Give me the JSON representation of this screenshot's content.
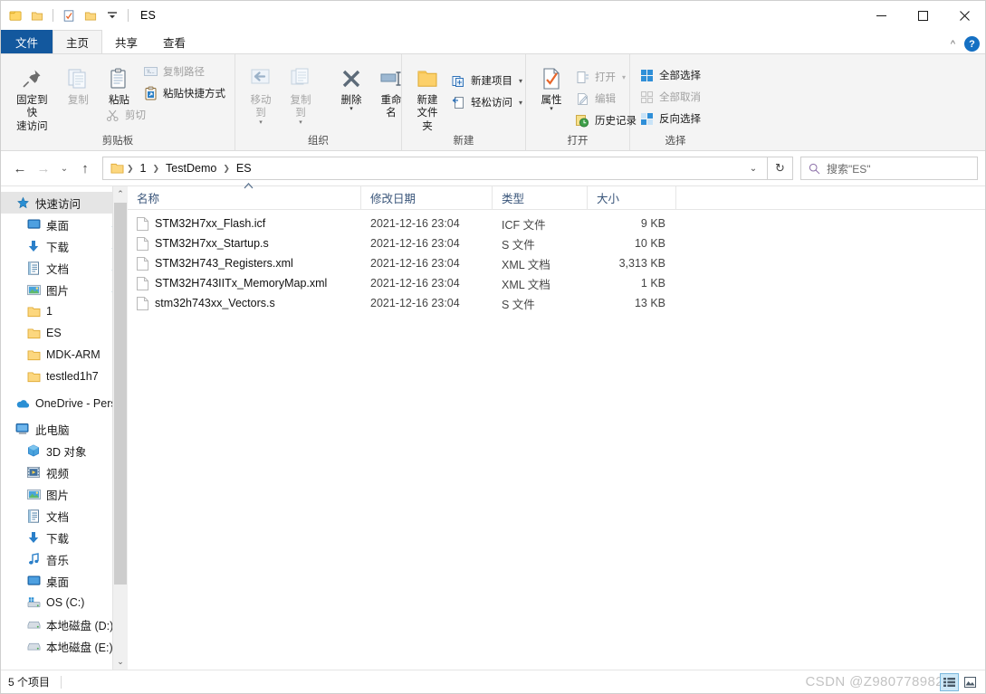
{
  "window": {
    "title": "ES",
    "quick_access": [
      "folder-icon",
      "properties-icon",
      "new-folder-icon",
      "dropdown-icon"
    ],
    "controls": {
      "minimize": "—",
      "maximize": "□",
      "close": "✕"
    }
  },
  "tabs": [
    {
      "label": "文件",
      "name": "tab-file"
    },
    {
      "label": "主页",
      "name": "tab-home"
    },
    {
      "label": "共享",
      "name": "tab-share"
    },
    {
      "label": "查看",
      "name": "tab-view"
    }
  ],
  "ribbon": {
    "collapse_label": "^",
    "help_label": "?",
    "groups": [
      {
        "name": "clipboard",
        "label": "剪贴板",
        "big": [
          {
            "label1": "固定到快",
            "label2": "速访问",
            "icon": "pin-icon",
            "disabled": false
          },
          {
            "label1": "复制",
            "label2": "",
            "icon": "copy-icon",
            "disabled": true
          },
          {
            "label1": "粘贴",
            "label2": "",
            "icon": "paste-icon",
            "disabled": false
          }
        ],
        "small": [
          {
            "label": "复制路径",
            "icon": "copy-path-icon",
            "disabled": true
          },
          {
            "label": "粘贴快捷方式",
            "icon": "paste-shortcut-icon",
            "disabled": false
          },
          {
            "label": "剪切",
            "icon": "scissors-icon",
            "disabled": true
          }
        ]
      },
      {
        "name": "organize",
        "label": "组织",
        "big": [
          {
            "label1": "移动到",
            "label2": "",
            "icon": "move-to-icon",
            "disabled": true,
            "caret": true
          },
          {
            "label1": "复制到",
            "label2": "",
            "icon": "copy-to-icon",
            "disabled": true,
            "caret": true
          },
          {
            "label1": "删除",
            "label2": "",
            "icon": "delete-icon",
            "disabled": false,
            "caret": true
          },
          {
            "label1": "重命名",
            "label2": "",
            "icon": "rename-icon",
            "disabled": false
          }
        ],
        "small": []
      },
      {
        "name": "new",
        "label": "新建",
        "big": [
          {
            "label1": "新建",
            "label2": "文件夹",
            "icon": "new-folder-icon",
            "disabled": false
          }
        ],
        "small": [
          {
            "label": "新建项目",
            "icon": "new-item-icon",
            "disabled": false,
            "caret": true
          },
          {
            "label": "轻松访问",
            "icon": "easy-access-icon",
            "disabled": false,
            "caret": true
          }
        ]
      },
      {
        "name": "open",
        "label": "打开",
        "big": [
          {
            "label1": "属性",
            "label2": "",
            "icon": "properties-icon",
            "disabled": false,
            "caret": true
          }
        ],
        "small": [
          {
            "label": "打开",
            "icon": "open-icon",
            "disabled": true,
            "caret": true
          },
          {
            "label": "编辑",
            "icon": "edit-icon",
            "disabled": true
          },
          {
            "label": "历史记录",
            "icon": "history-icon",
            "disabled": false
          }
        ]
      },
      {
        "name": "select",
        "label": "选择",
        "big": [],
        "small": [
          {
            "label": "全部选择",
            "icon": "select-all-icon",
            "disabled": false
          },
          {
            "label": "全部取消",
            "icon": "select-none-icon",
            "disabled": true
          },
          {
            "label": "反向选择",
            "icon": "invert-selection-icon",
            "disabled": false
          }
        ]
      }
    ]
  },
  "addressbar": {
    "back": "←",
    "forward": "→",
    "recent": "⌄",
    "up": "↑",
    "breadcrumbs": [
      "1",
      "TestDemo",
      "ES"
    ],
    "breadcrumb_dropdown": "⌄",
    "refresh": "↻",
    "search": {
      "placeholder": "搜索\"ES\"",
      "icon": "search-icon"
    }
  },
  "sidebar": {
    "items": [
      {
        "label": "快速访问",
        "icon": "star-icon",
        "level": 0,
        "selected": true,
        "pinned": false
      },
      {
        "label": "桌面",
        "icon": "desktop-icon",
        "level": 1,
        "selected": false,
        "pinned": true
      },
      {
        "label": "下载",
        "icon": "download-icon",
        "level": 1,
        "selected": false,
        "pinned": true
      },
      {
        "label": "文档",
        "icon": "documents-icon",
        "level": 1,
        "selected": false,
        "pinned": true
      },
      {
        "label": "图片",
        "icon": "pictures-icon",
        "level": 1,
        "selected": false,
        "pinned": true
      },
      {
        "label": "1",
        "icon": "folder-icon",
        "level": 1,
        "selected": false,
        "pinned": false
      },
      {
        "label": "ES",
        "icon": "folder-icon",
        "level": 1,
        "selected": false,
        "pinned": false
      },
      {
        "label": "MDK-ARM",
        "icon": "folder-icon",
        "level": 1,
        "selected": false,
        "pinned": false
      },
      {
        "label": "testled1h7",
        "icon": "folder-icon",
        "level": 1,
        "selected": false,
        "pinned": false
      },
      {
        "label": "OneDrive - Pers",
        "icon": "onedrive-icon",
        "level": 0,
        "selected": false,
        "pinned": false
      },
      {
        "label": "此电脑",
        "icon": "this-pc-icon",
        "level": 0,
        "selected": false,
        "pinned": false
      },
      {
        "label": "3D 对象",
        "icon": "3d-objects-icon",
        "level": 1,
        "selected": false,
        "pinned": false
      },
      {
        "label": "视频",
        "icon": "videos-icon",
        "level": 1,
        "selected": false,
        "pinned": false
      },
      {
        "label": "图片",
        "icon": "pictures-icon",
        "level": 1,
        "selected": false,
        "pinned": false
      },
      {
        "label": "文档",
        "icon": "documents-icon",
        "level": 1,
        "selected": false,
        "pinned": false
      },
      {
        "label": "下载",
        "icon": "download-icon",
        "level": 1,
        "selected": false,
        "pinned": false
      },
      {
        "label": "音乐",
        "icon": "music-icon",
        "level": 1,
        "selected": false,
        "pinned": false
      },
      {
        "label": "桌面",
        "icon": "desktop-icon",
        "level": 1,
        "selected": false,
        "pinned": false
      },
      {
        "label": "OS (C:)",
        "icon": "os-drive-icon",
        "level": 1,
        "selected": false,
        "pinned": false
      },
      {
        "label": "本地磁盘 (D:)",
        "icon": "drive-icon",
        "level": 1,
        "selected": false,
        "pinned": false
      },
      {
        "label": "本地磁盘 (E:)",
        "icon": "drive-icon",
        "level": 1,
        "selected": false,
        "pinned": false
      }
    ],
    "scroll_up": "⌃",
    "scroll_down": "⌄"
  },
  "filelist": {
    "columns": [
      {
        "label": "名称",
        "key": "name"
      },
      {
        "label": "修改日期",
        "key": "date"
      },
      {
        "label": "类型",
        "key": "type"
      },
      {
        "label": "大小",
        "key": "size"
      }
    ],
    "sort_indicator": "⌃",
    "rows": [
      {
        "name": "STM32H7xx_Flash.icf",
        "date": "2021-12-16 23:04",
        "type": "ICF 文件",
        "size": "9 KB",
        "icon": "file-icon"
      },
      {
        "name": "STM32H7xx_Startup.s",
        "date": "2021-12-16 23:04",
        "type": "S 文件",
        "size": "10 KB",
        "icon": "file-icon"
      },
      {
        "name": "STM32H743_Registers.xml",
        "date": "2021-12-16 23:04",
        "type": "XML 文档",
        "size": "3,313 KB",
        "icon": "file-icon"
      },
      {
        "name": "STM32H743IITx_MemoryMap.xml",
        "date": "2021-12-16 23:04",
        "type": "XML 文档",
        "size": "1 KB",
        "icon": "file-icon"
      },
      {
        "name": "stm32h743xx_Vectors.s",
        "date": "2021-12-16 23:04",
        "type": "S 文件",
        "size": "13 KB",
        "icon": "file-icon"
      }
    ]
  },
  "statusbar": {
    "item_count": "5 个项目",
    "views": [
      {
        "name": "details-view-button",
        "active": true
      },
      {
        "name": "large-icons-view-button",
        "active": false
      }
    ],
    "watermark": "CSDN @Z980778982"
  },
  "colors": {
    "accent": "#13589e",
    "folder": "#ffd666",
    "header_text": "#39557a",
    "selection": "#e5e5e5",
    "watermark": "#c3c3c3"
  }
}
